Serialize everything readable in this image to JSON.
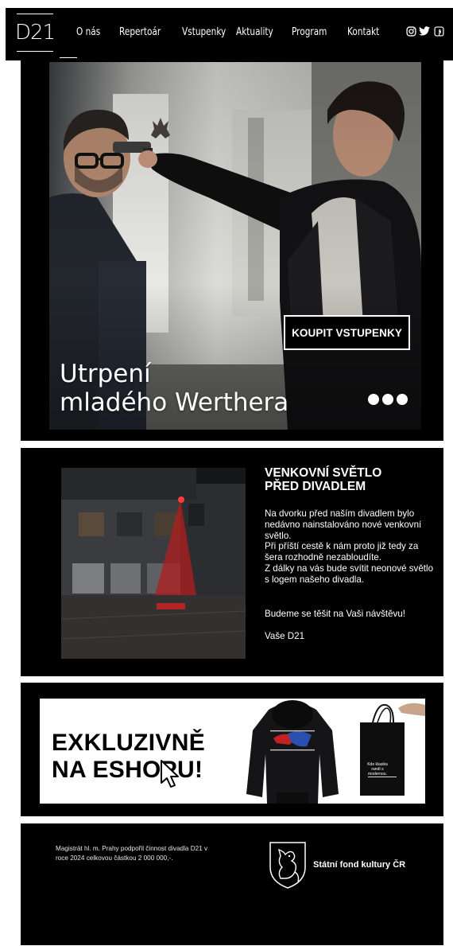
{
  "nav": {
    "logo": "D21",
    "items": [
      "O nás",
      "Repertoár",
      "Vstupenky",
      "Aktuality",
      "Program",
      "Kontakt"
    ],
    "social_icons": [
      "instagram-icon",
      "twitter-icon",
      "facebook-icon"
    ]
  },
  "hero": {
    "buy_button": "KOUPIT VSTUPENKY",
    "title_line1": "Utrpení",
    "title_line2": "mladého Werthera",
    "slider_dots": 3
  },
  "news": {
    "title": "VENKOVNÍ SVĚTLO\nPŘED DIVADLEM",
    "body": "Na dvorku před naším divadlem bylo nedávno nainstalováno nové venkovní světlo.\nPři příští cestě k nám proto již tedy za šera rozhodně nezabloudíte.\nZ dálky na vás bude svítit neonové světlo s logem našeho divadla.",
    "greeting": "Budeme se těšit na Vaši návštěvu!",
    "signature": "Vaše D21"
  },
  "eshop": {
    "headline_line1": "EXKLUZIVNĚ",
    "headline_line2": "NA ESHOPU!",
    "bag_text": "Kde klasika randí s modernou."
  },
  "footer": {
    "support_note": "Magistrát hl. m. Prahy podpořil činnost divadla D21 v roce 2024 celkovou částkou 2 000 000,-.",
    "fund_name": "Státní fond kultury ČR"
  }
}
